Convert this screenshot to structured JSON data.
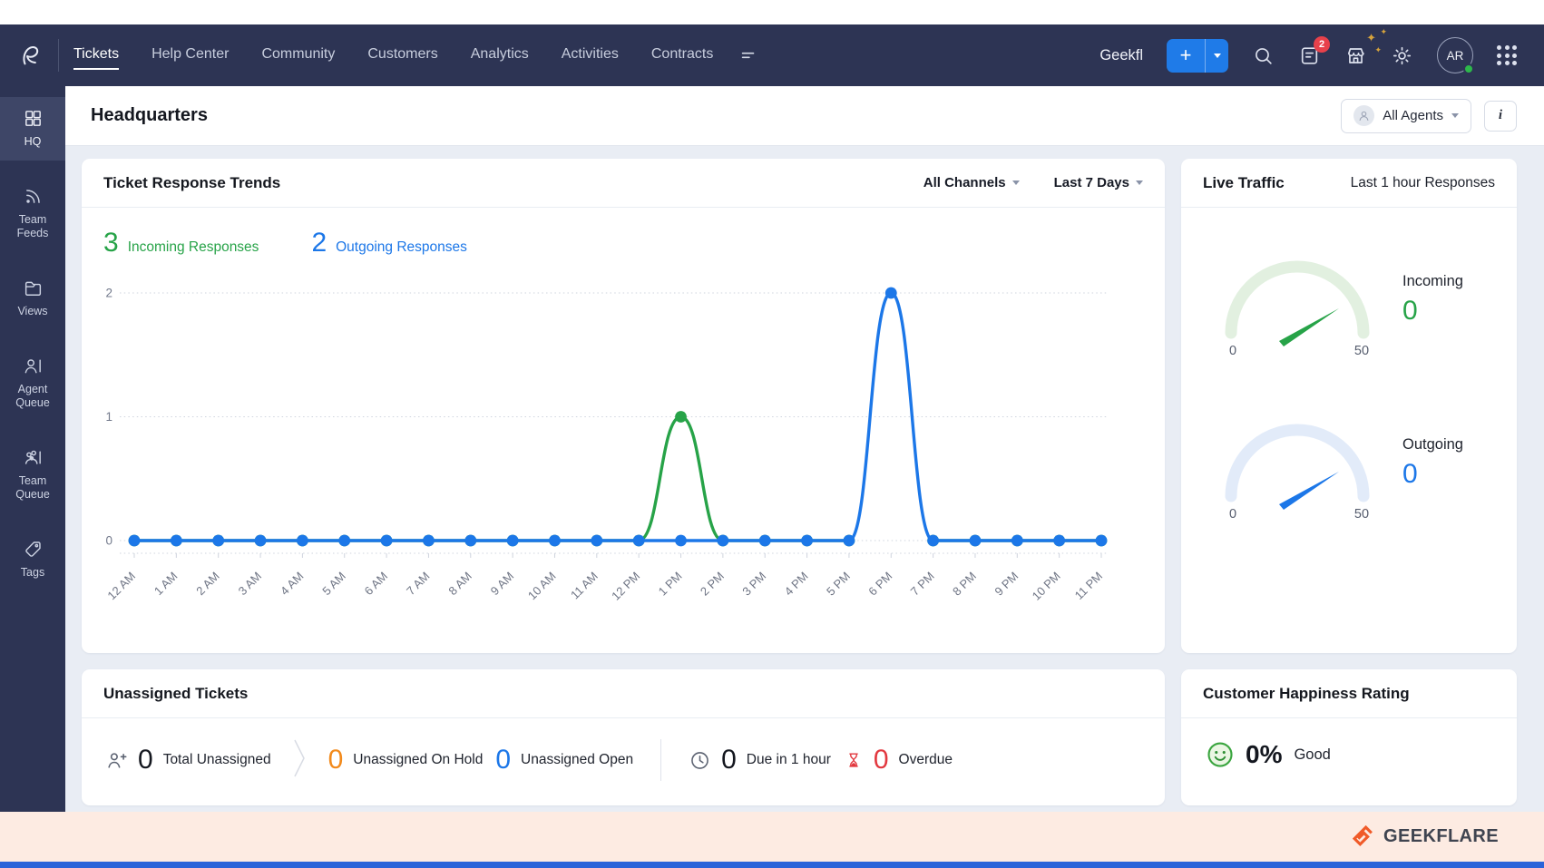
{
  "topbar": {
    "brand": "Geekfl",
    "nav": [
      {
        "label": "Tickets",
        "active": true
      },
      {
        "label": "Help Center",
        "active": false
      },
      {
        "label": "Community",
        "active": false
      },
      {
        "label": "Customers",
        "active": false
      },
      {
        "label": "Analytics",
        "active": false
      },
      {
        "label": "Activities",
        "active": false
      },
      {
        "label": "Contracts",
        "active": false
      }
    ],
    "add_label": "+",
    "notification_count": "2",
    "avatar_initials": "AR"
  },
  "sidebar": {
    "items": [
      {
        "label": "HQ",
        "icon": "dashboard-grid",
        "active": true
      },
      {
        "label": "Team Feeds",
        "icon": "feeds",
        "active": false
      },
      {
        "label": "Views",
        "icon": "folder",
        "active": false
      },
      {
        "label": "Agent Queue",
        "icon": "agent-queue",
        "active": false
      },
      {
        "label": "Team Queue",
        "icon": "team-queue",
        "active": false
      },
      {
        "label": "Tags",
        "icon": "tag",
        "active": false
      }
    ]
  },
  "header": {
    "title": "Headquarters",
    "agent_filter": "All Agents",
    "info_label": "i"
  },
  "trends": {
    "title": "Ticket Response Trends",
    "channel_filter": "All Channels",
    "range_filter": "Last 7 Days",
    "legend": [
      {
        "value": "3",
        "label": "Incoming Responses",
        "color": "#27a348"
      },
      {
        "value": "2",
        "label": "Outgoing Responses",
        "color": "#1c77e8"
      }
    ]
  },
  "chart_data": {
    "type": "line",
    "title": "Ticket Response Trends",
    "x": [
      "12 AM",
      "1 AM",
      "2 AM",
      "3 AM",
      "4 AM",
      "5 AM",
      "6 AM",
      "7 AM",
      "8 AM",
      "9 AM",
      "10 AM",
      "11 AM",
      "12 PM",
      "1 PM",
      "2 PM",
      "3 PM",
      "4 PM",
      "5 PM",
      "6 PM",
      "7 PM",
      "8 PM",
      "9 PM",
      "10 PM",
      "11 PM"
    ],
    "series": [
      {
        "name": "Incoming Responses",
        "color": "#27a348",
        "values": [
          0,
          0,
          0,
          0,
          0,
          0,
          0,
          0,
          0,
          0,
          0,
          0,
          0,
          1,
          0,
          0,
          0,
          0,
          null,
          0,
          0,
          0,
          0,
          0
        ]
      },
      {
        "name": "Outgoing Responses",
        "color": "#1c77e8",
        "values": [
          0,
          0,
          0,
          0,
          0,
          0,
          0,
          0,
          0,
          0,
          0,
          0,
          0,
          0,
          0,
          0,
          0,
          0,
          2,
          0,
          0,
          0,
          0,
          0
        ]
      }
    ],
    "ylim": [
      0,
      2
    ],
    "yticks": [
      0,
      1,
      2
    ],
    "grid": "dotted horizontal",
    "legend_position": "top-left"
  },
  "traffic": {
    "title": "Live Traffic",
    "subtitle": "Last 1 hour Responses",
    "gauges": [
      {
        "label": "Incoming",
        "value": "0",
        "min": "0",
        "max": "50",
        "color": "#27a348",
        "track": "#e2f0e0"
      },
      {
        "label": "Outgoing",
        "value": "0",
        "min": "0",
        "max": "50",
        "color": "#1c77e8",
        "track": "#e2ebf9"
      }
    ]
  },
  "unassigned": {
    "title": "Unassigned Tickets",
    "stats": [
      {
        "icon": "person-add",
        "value": "0",
        "label": "Total Unassigned",
        "color": "#14171f",
        "divider_after": "chevron"
      },
      {
        "icon": null,
        "value": "0",
        "label": "Unassigned On Hold",
        "color": "#f28a1c",
        "divider_after": null
      },
      {
        "icon": null,
        "value": "0",
        "label": "Unassigned Open",
        "color": "#1c77e8",
        "divider_after": "line"
      },
      {
        "icon": "clock",
        "value": "0",
        "label": "Due in 1 hour",
        "color": "#14171f",
        "divider_after": null
      },
      {
        "icon": "hourglass",
        "value": "0",
        "label": "Overdue",
        "color": "#e2383f",
        "divider_after": null
      }
    ]
  },
  "happiness": {
    "title": "Customer Happiness Rating",
    "value": "0%",
    "label": "Good"
  },
  "footer": {
    "brand": "GEEKFLARE"
  },
  "colors": {
    "navy": "#2d3454",
    "accent_blue": "#1c77e8",
    "green": "#27a348",
    "orange": "#f28a1c",
    "red": "#e2383f",
    "footer_peach": "#fdebe2"
  }
}
